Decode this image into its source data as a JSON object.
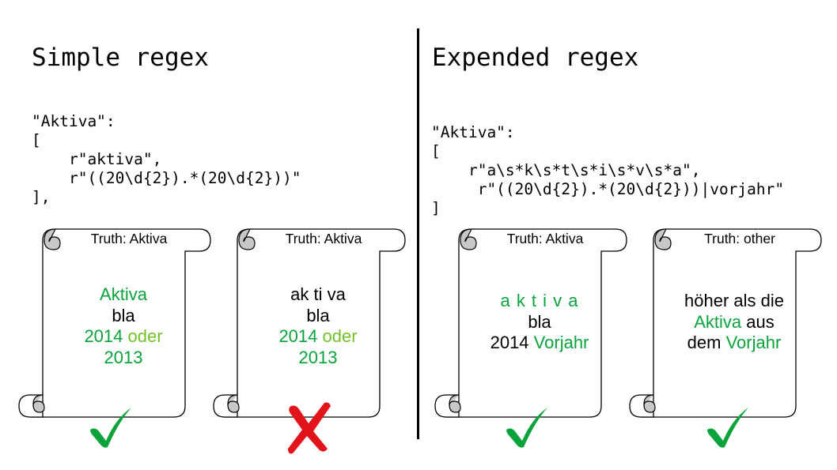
{
  "left": {
    "title": "Simple regex",
    "code": [
      "\"Aktiva\":",
      "[",
      "    r\"aktiva\",",
      "    r\"((20\\d{2}).*(20\\d{2}))\"",
      "],"
    ]
  },
  "right": {
    "title": "Expended regex",
    "code": [
      "\"Aktiva\":",
      "[",
      "    r\"a\\s*k\\s*t\\s*i\\s*v\\s*a\",",
      "     r\"((20\\d{2}).*(20\\d{2}))|vorjahr\"",
      "]"
    ]
  },
  "cards": [
    {
      "truth": "Truth: Aktiva",
      "l1": "Aktiva",
      "l2": "bla",
      "l3a": "2014",
      "l3b": "oder",
      "l4": "2013",
      "result": "check"
    },
    {
      "truth": "Truth: Aktiva",
      "l1": "ak ti va",
      "l2": "bla",
      "l3a": "2014",
      "l3b": "oder",
      "l4": "2013",
      "result": "cross"
    },
    {
      "truth": "Truth: Aktiva",
      "l1": "a k t i v a",
      "l2": "bla",
      "l3a": "2014",
      "l3b": "Vorjahr",
      "result": "check"
    },
    {
      "truth": "Truth: other",
      "l1": "höher als die",
      "l2a": "Aktiva",
      "l2b": "aus",
      "l3a": "dem",
      "l3b": "Vorjahr",
      "result": "check"
    }
  ],
  "colors": {
    "match_green": "#0aa33b",
    "light_green": "#74c12a",
    "cross_red": "#e3131b",
    "scroll_curl": "#c8c8c8"
  }
}
